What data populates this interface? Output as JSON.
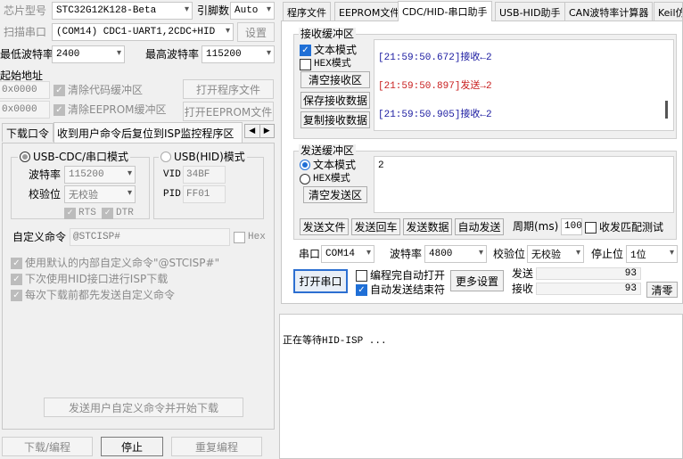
{
  "left": {
    "chip_label": "芯片型号",
    "chip_value": "STC32G12K128-Beta",
    "pin_label": "引脚数",
    "pin_value": "Auto",
    "scan_label": "扫描串口",
    "scan_value": "(COM14) CDC1-UART1,2CDC+HID",
    "settings_btn": "设置",
    "min_baud_label": "最低波特率",
    "min_baud_value": "2400",
    "max_baud_label": "最高波特率",
    "max_baud_value": "115200",
    "start_addr_label": "起始地址",
    "addr1": "0x0000",
    "addr2": "0x0000",
    "clear_code": "清除代码缓冲区",
    "clear_eeprom": "清除EEPROM缓冲区",
    "open_program": "打开程序文件",
    "open_eeprom": "打开EEPROM文件",
    "tab_download": "下载口令",
    "tab_reset": "收到用户命令后复位到ISP监控程序区",
    "usb_cdc_mode": "USB-CDC/串口模式",
    "usb_hid_mode": "USB(HID)模式",
    "baud_label": "波特率",
    "baud_value": "115200",
    "parity_label": "校验位",
    "parity_value": "无校验",
    "rts": "RTS",
    "dtr": "DTR",
    "vid_label": "VID",
    "vid_value": "34BF",
    "pid_label": "PID",
    "pid_value": "FF01",
    "custom_cmd_label": "自定义命令",
    "custom_cmd_value": "@STCISP#",
    "hex_label": "Hex",
    "opt1": "使用默认的内部自定义命令\"@STCISP#\"",
    "opt2": "下次使用HID接口进行ISP下载",
    "opt3": "每次下载前都先发送自定义命令",
    "send_start_btn": "发送用户自定义命令并开始下载",
    "download_btn": "下载/编程",
    "stop_btn": "停止",
    "reprogram_btn": "重复编程"
  },
  "tabs": [
    "程序文件",
    "EEPROM文件",
    "CDC/HID-串口助手",
    "USB-HID助手",
    "CAN波特率计算器",
    "Keil仿"
  ],
  "recv": {
    "group": "接收缓冲区",
    "text_mode": "文本模式",
    "hex_mode": "HEX模式",
    "clear": "清空接收区",
    "save": "保存接收数据",
    "copy": "复制接收数据",
    "lines": [
      {
        "text": "[21:59:50.672]接收←2",
        "color": "#1a1aa0"
      },
      {
        "text": "[21:59:50.897]发送→2",
        "color": "#c81e1e"
      },
      {
        "text": "[21:59:50.905]接收←2",
        "color": "#1a1aa0"
      }
    ]
  },
  "send": {
    "group": "发送缓冲区",
    "text_mode": "文本模式",
    "hex_mode": "HEX模式",
    "clear": "清空发送区",
    "content": "2",
    "send_file": "发送文件",
    "send_return": "发送回车",
    "send_data": "发送数据",
    "auto_send": "自动发送",
    "period_label": "周期(ms)",
    "period_value": "100",
    "match_test": "收发匹配测试"
  },
  "port": {
    "port_label": "串口",
    "port_value": "COM14",
    "baud_label": "波特率",
    "baud_value": "4800",
    "parity_label": "校验位",
    "parity_value": "无校验",
    "stop_label": "停止位",
    "stop_value": "1位",
    "open_btn": "打开串口",
    "auto_open": "编程完自动打开",
    "auto_end": "自动发送结束符",
    "more": "更多设置",
    "sent_label": "发送",
    "sent_value": "93",
    "recv_label": "接收",
    "recv_value": "93",
    "clear_btn": "清零"
  },
  "status": {
    "waiting": "正在等待HID-ISP ..."
  }
}
